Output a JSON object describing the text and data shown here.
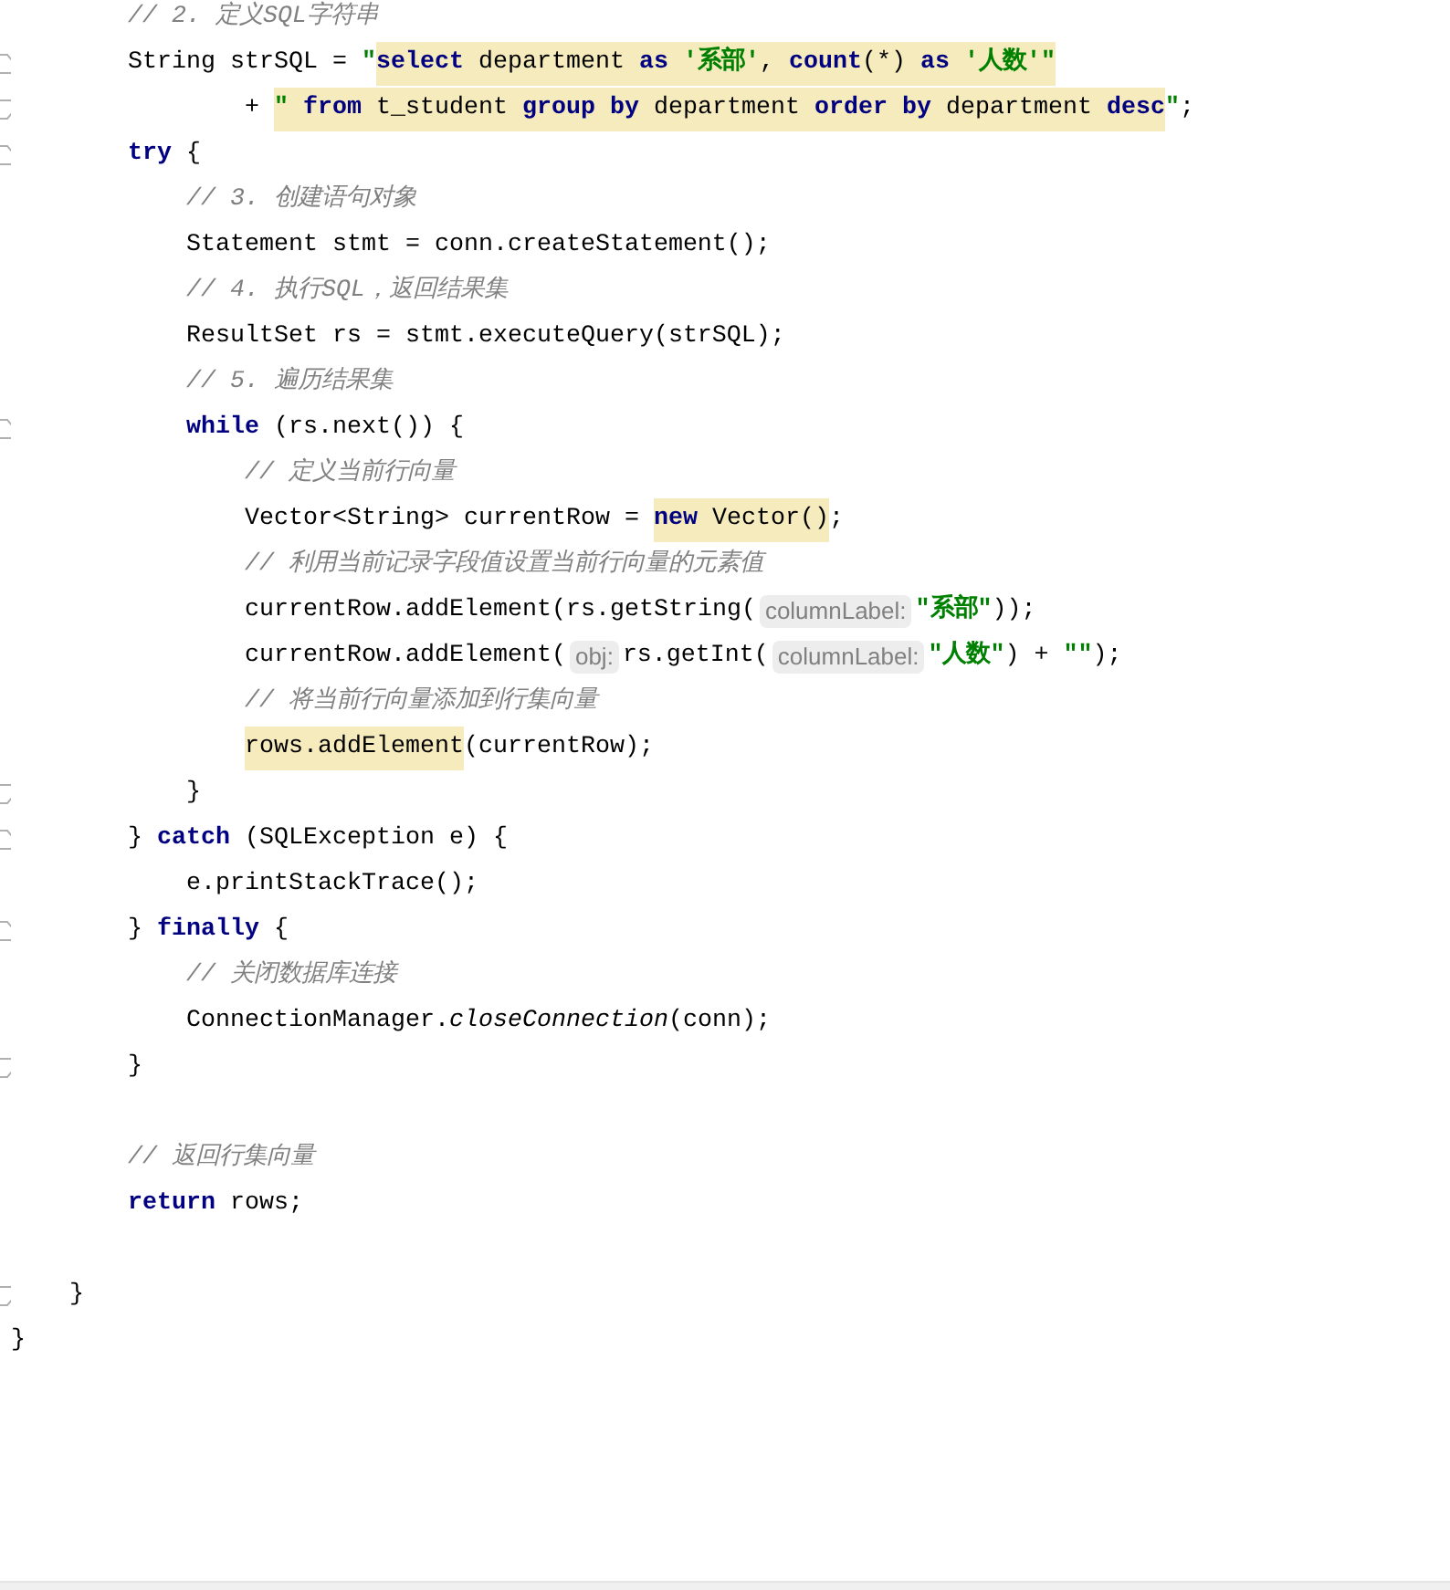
{
  "lines": [
    {
      "kind": "group",
      "children": [
        {
          "kind": "group",
          "children": [
            {
              "kind": "code",
              "tokens": [
                {
                  "kind": "comment",
                  "text": "// 2. 定义SQL字符串"
                }
              ]
            },
            {
              "kind": "code",
              "fold_marker": {
                "kind": "start"
              },
              "tokens": [
                {
                  "kind": "plain",
                  "text": "String strSQL = "
                },
                {
                  "kind": "string",
                  "text": "\""
                },
                {
                  "kind": "keyword",
                  "text": "select",
                  "highlight": true
                },
                {
                  "kind": "plain",
                  "text": " department ",
                  "highlight": true
                },
                {
                  "kind": "keyword",
                  "text": "as",
                  "highlight": true
                },
                {
                  "kind": "string",
                  "text": " '系部'",
                  "highlight": true
                },
                {
                  "kind": "plain",
                  "text": ", ",
                  "highlight": true
                },
                {
                  "kind": "keyword",
                  "text": "count",
                  "highlight": true
                },
                {
                  "kind": "plain",
                  "text": "(*) ",
                  "highlight": true
                },
                {
                  "kind": "keyword",
                  "text": "as",
                  "highlight": true
                },
                {
                  "kind": "string",
                  "text": " '人数'\"",
                  "highlight": true
                }
              ]
            },
            {
              "kind": "continuation",
              "fold_marker": {
                "kind": "end"
              },
              "tokens": [
                {
                  "kind": "plain",
                  "text": "+ "
                },
                {
                  "kind": "string",
                  "text": "\" ",
                  "highlight": true
                },
                {
                  "kind": "keyword",
                  "text": "from",
                  "highlight": true
                },
                {
                  "kind": "plain",
                  "text": " t_student ",
                  "highlight": true
                },
                {
                  "kind": "keyword",
                  "text": "group by",
                  "highlight": true
                },
                {
                  "kind": "plain",
                  "text": " department ",
                  "highlight": true
                },
                {
                  "kind": "keyword",
                  "text": "order by",
                  "highlight": true
                },
                {
                  "kind": "plain",
                  "text": " department ",
                  "highlight": true
                },
                {
                  "kind": "keyword",
                  "text": "desc",
                  "highlight": true
                },
                {
                  "kind": "string",
                  "text": "\""
                },
                {
                  "kind": "plain",
                  "text": ";"
                }
              ]
            },
            {
              "kind": "code",
              "fold_marker": {
                "kind": "start"
              },
              "tokens": [
                {
                  "kind": "keyword",
                  "text": "try"
                },
                {
                  "kind": "plain",
                  "text": " {"
                }
              ],
              "children": [
                {
                  "kind": "code",
                  "tokens": [
                    {
                      "kind": "comment",
                      "text": "// 3. 创建语句对象"
                    }
                  ]
                },
                {
                  "kind": "code",
                  "tokens": [
                    {
                      "kind": "plain",
                      "text": "Statement stmt = conn.createStatement();"
                    }
                  ]
                },
                {
                  "kind": "code",
                  "tokens": [
                    {
                      "kind": "comment",
                      "text": "// 4. 执行SQL，返回结果集"
                    }
                  ]
                },
                {
                  "kind": "code",
                  "tokens": [
                    {
                      "kind": "plain",
                      "text": "ResultSet rs = stmt.executeQuery(strSQL);"
                    }
                  ]
                },
                {
                  "kind": "code",
                  "tokens": [
                    {
                      "kind": "comment",
                      "text": "// 5. 遍历结果集"
                    }
                  ]
                },
                {
                  "kind": "code",
                  "fold_marker": {
                    "kind": "start"
                  },
                  "tokens": [
                    {
                      "kind": "keyword",
                      "text": "while"
                    },
                    {
                      "kind": "plain",
                      "text": " (rs.next()) {"
                    }
                  ],
                  "children": [
                    {
                      "kind": "code",
                      "tokens": [
                        {
                          "kind": "comment",
                          "text": "// 定义当前行向量"
                        }
                      ]
                    },
                    {
                      "kind": "code",
                      "tokens": [
                        {
                          "kind": "plain",
                          "text": "Vector<String> currentRow = "
                        },
                        {
                          "kind": "keyword",
                          "text": "new",
                          "highlight": true
                        },
                        {
                          "kind": "plain",
                          "text": " Vector()",
                          "highlight": true
                        },
                        {
                          "kind": "plain",
                          "text": ";"
                        }
                      ]
                    },
                    {
                      "kind": "code",
                      "tokens": [
                        {
                          "kind": "comment",
                          "text": "// 利用当前记录字段值设置当前行向量的元素值"
                        }
                      ]
                    },
                    {
                      "kind": "code",
                      "tokens": [
                        {
                          "kind": "plain",
                          "text": "currentRow.addElement(rs.getString("
                        },
                        {
                          "kind": "hint",
                          "text": "columnLabel:"
                        },
                        {
                          "kind": "string",
                          "text": "\"系部\""
                        },
                        {
                          "kind": "plain",
                          "text": "));"
                        }
                      ]
                    },
                    {
                      "kind": "code",
                      "tokens": [
                        {
                          "kind": "plain",
                          "text": "currentRow.addElement("
                        },
                        {
                          "kind": "hint",
                          "text": "obj:"
                        },
                        {
                          "kind": "plain",
                          "text": "rs.getInt("
                        },
                        {
                          "kind": "hint",
                          "text": "columnLabel:"
                        },
                        {
                          "kind": "string",
                          "text": "\"人数\""
                        },
                        {
                          "kind": "plain",
                          "text": ") + "
                        },
                        {
                          "kind": "string",
                          "text": "\"\""
                        },
                        {
                          "kind": "plain",
                          "text": ");"
                        }
                      ]
                    },
                    {
                      "kind": "code",
                      "tokens": [
                        {
                          "kind": "comment",
                          "text": "// 将当前行向量添加到行集向量"
                        }
                      ]
                    },
                    {
                      "kind": "code",
                      "tokens": [
                        {
                          "kind": "plain",
                          "text": "rows.addElement",
                          "highlight": true
                        },
                        {
                          "kind": "plain",
                          "text": "(currentRow);"
                        }
                      ]
                    }
                  ]
                },
                {
                  "kind": "code",
                  "fold_marker": {
                    "kind": "end"
                  },
                  "tokens": [
                    {
                      "kind": "plain",
                      "text": "}"
                    }
                  ]
                }
              ]
            },
            {
              "kind": "code",
              "fold_marker": {
                "kind": "start"
              },
              "tokens": [
                {
                  "kind": "plain",
                  "text": "} "
                },
                {
                  "kind": "keyword",
                  "text": "catch"
                },
                {
                  "kind": "plain",
                  "text": " (SQLException e) {"
                }
              ],
              "children": [
                {
                  "kind": "code",
                  "tokens": [
                    {
                      "kind": "plain",
                      "text": "e.printStackTrace();"
                    }
                  ]
                }
              ]
            },
            {
              "kind": "code",
              "fold_marker": {
                "kind": "start"
              },
              "tokens": [
                {
                  "kind": "plain",
                  "text": "} "
                },
                {
                  "kind": "keyword",
                  "text": "finally"
                },
                {
                  "kind": "plain",
                  "text": " {"
                }
              ],
              "children": [
                {
                  "kind": "code",
                  "tokens": [
                    {
                      "kind": "comment",
                      "text": "// 关闭数据库连接"
                    }
                  ]
                },
                {
                  "kind": "code",
                  "tokens": [
                    {
                      "kind": "plain",
                      "text": "ConnectionManager."
                    },
                    {
                      "kind": "static",
                      "text": "closeConnection"
                    },
                    {
                      "kind": "plain",
                      "text": "(conn);"
                    }
                  ]
                }
              ]
            },
            {
              "kind": "code",
              "fold_marker": {
                "kind": "end"
              },
              "tokens": [
                {
                  "kind": "plain",
                  "text": "}"
                }
              ]
            },
            {
              "kind": "blank"
            },
            {
              "kind": "code",
              "tokens": [
                {
                  "kind": "comment",
                  "text": "// 返回行集向量"
                }
              ]
            },
            {
              "kind": "code",
              "tokens": [
                {
                  "kind": "keyword",
                  "text": "return"
                },
                {
                  "kind": "plain",
                  "text": " rows;"
                }
              ]
            },
            {
              "kind": "blank"
            }
          ]
        },
        {
          "kind": "code",
          "fold_marker": {
            "kind": "end"
          },
          "tokens": [
            {
              "kind": "plain",
              "text": "}"
            }
          ]
        }
      ]
    },
    {
      "kind": "code",
      "tokens": [
        {
          "kind": "plain",
          "text": "}"
        }
      ]
    }
  ]
}
